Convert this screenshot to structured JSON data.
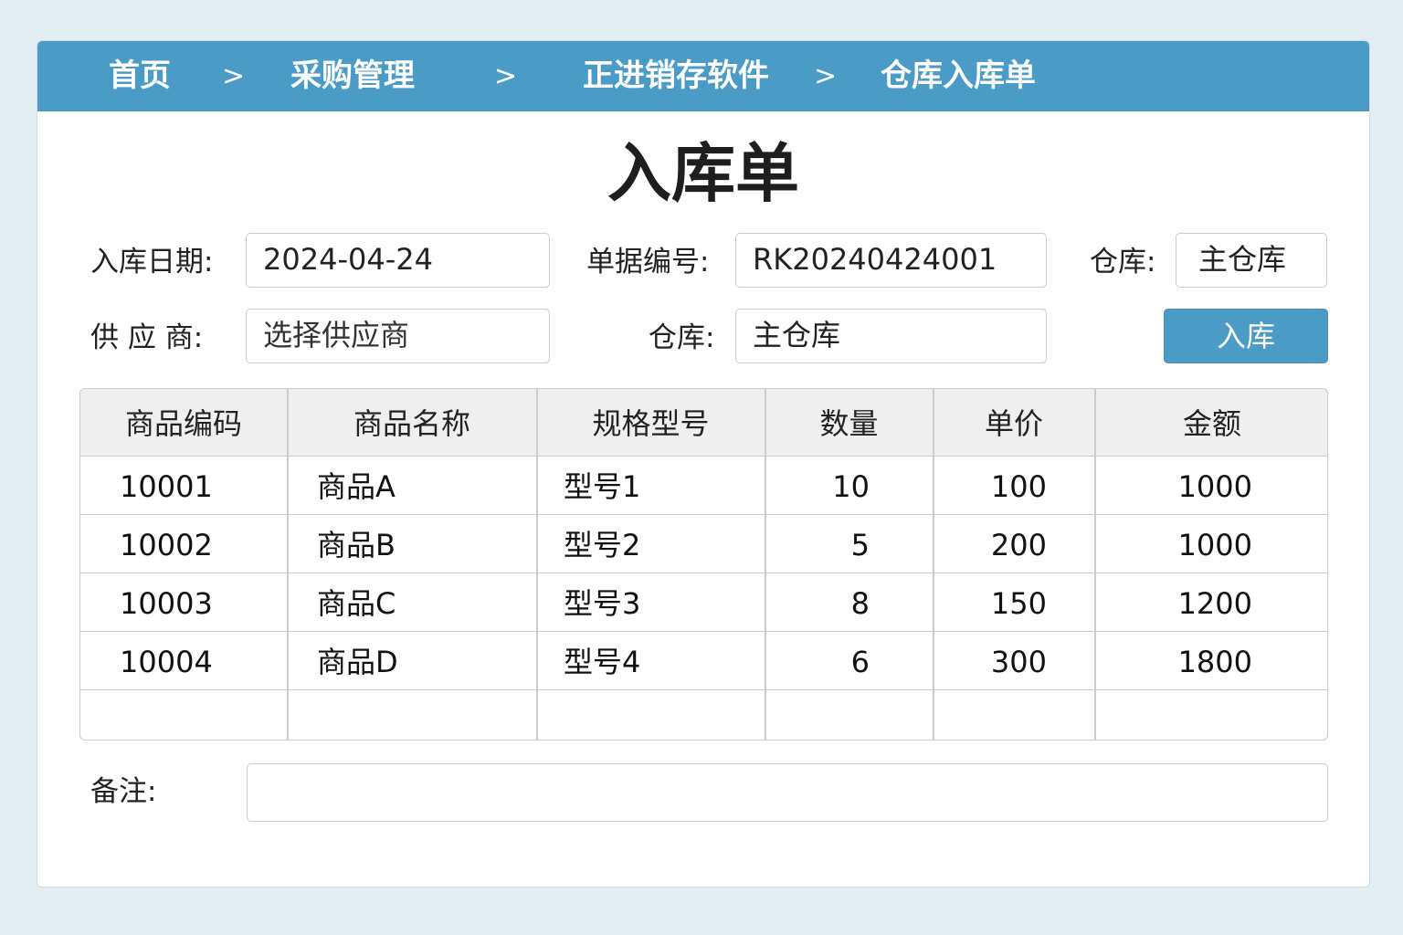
{
  "breadcrumb": {
    "items": [
      "首页",
      "采购管理",
      "正进销存软件",
      "仓库入库单"
    ],
    "separator": ">"
  },
  "form": {
    "title": "入库单",
    "date_label": "入库日期:",
    "date_value": "2024-04-24",
    "doc_no_label": "单据编号:",
    "doc_no_value": "RK20240424001",
    "warehouse_top_label": "仓库:",
    "warehouse_top_value": "主仓库",
    "supplier_label": "供 应 商:",
    "supplier_placeholder": "选择供应商",
    "warehouse_label": "仓库:",
    "warehouse_value": "主仓库",
    "submit_label": "入库",
    "remark_label": "备注:",
    "remark_value": ""
  },
  "table": {
    "columns": [
      "商品编码",
      "商品名称",
      "规格型号",
      "数量",
      "单价",
      "金额"
    ],
    "rows": [
      [
        "10001",
        "商品A",
        "型号1",
        "10",
        "100",
        "1000"
      ],
      [
        "10002",
        "商品B",
        "型号2",
        "5",
        "200",
        "1000"
      ],
      [
        "10003",
        "商品C",
        "型号3",
        "8",
        "150",
        "1200"
      ],
      [
        "10004",
        "商品D",
        "型号4",
        "6",
        "300",
        "1800"
      ],
      [
        "",
        "",
        "",
        "",
        "",
        ""
      ]
    ]
  },
  "colors": {
    "accent": "#4a9cc7",
    "background": "#e2eef1",
    "header_row": "#efefef"
  }
}
